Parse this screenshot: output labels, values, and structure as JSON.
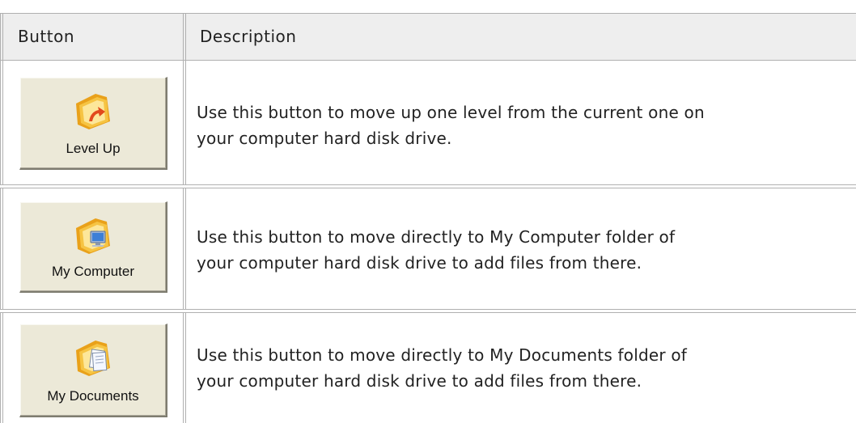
{
  "table": {
    "headers": {
      "button": "Button",
      "description": "Description"
    },
    "rows": [
      {
        "button_label": "Level Up",
        "icon": "level-up-folder-icon",
        "description_line1": "Use this button to move up one level from the current one on",
        "description_line2": "your computer hard disk drive."
      },
      {
        "button_label": "My Computer",
        "icon": "my-computer-folder-icon",
        "description_line1": "Use this button to move directly to My Computer folder of",
        "description_line2": "your computer hard disk drive to add files from there."
      },
      {
        "button_label": "My Documents",
        "icon": "my-documents-folder-icon",
        "description_line1": "Use this button to move directly to My Documents folder of",
        "description_line2": "your computer hard disk drive to add files from there."
      }
    ]
  },
  "colors": {
    "header_bg": "#eeeeee",
    "grid_line": "#b0b0b0",
    "button_face": "#ece9d8",
    "folder_yellow": "#f6c443",
    "folder_orange": "#e9a11a",
    "arrow_red": "#e24a1c",
    "monitor_blue": "#3d7fd6"
  }
}
